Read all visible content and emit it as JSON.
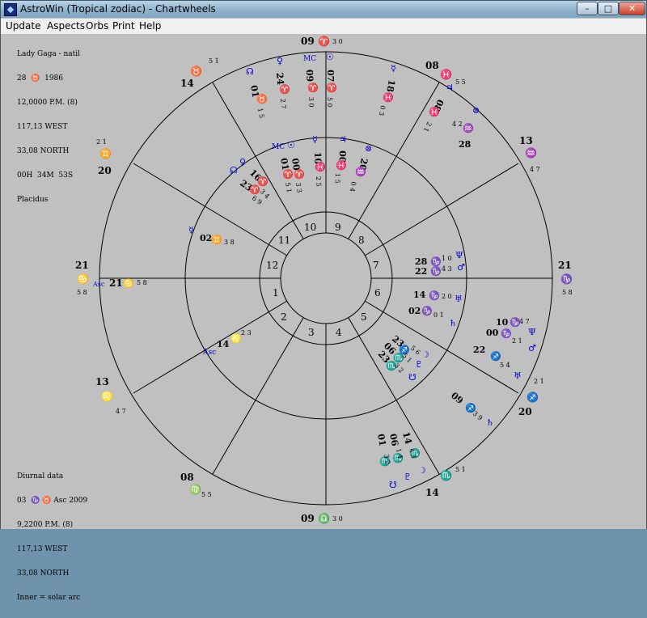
{
  "window": {
    "title": "AstroWin (Tropical zodiac) - Chartwheels",
    "min_label": "–",
    "max_label": "□",
    "close_label": "✕"
  },
  "menu": [
    "Update",
    "Aspects",
    "Orbs",
    "Print",
    "Help"
  ],
  "natal_info": [
    "Lady Gaga - natil",
    "28  ♉  1986",
    "12,0000 P.M. (8)",
    "117,13 WEST",
    "33,08 NORTH",
    "00H  34M  53S",
    "Placidus"
  ],
  "diurnal_info": [
    "Diurnal data",
    "03  ♑ ♉ Asc 2009",
    "9,2200 P.M. (8)",
    "117,13 WEST",
    "33,08 NORTH",
    "Inner = solar arc"
  ],
  "houses": [
    "1",
    "2",
    "3",
    "4",
    "5",
    "6",
    "7",
    "8",
    "9",
    "10",
    "11",
    "12"
  ],
  "outer_cusps": {
    "mc": {
      "deg": "09",
      "sign": "♈",
      "min": "3 0"
    },
    "h11": {
      "deg": "08",
      "sign": "♓",
      "min": "5 5"
    },
    "h12": {
      "deg": "13",
      "sign": "♒",
      "min": "4 7"
    },
    "asc": {
      "deg": "21",
      "sign": "♑",
      "min": "5 8"
    },
    "h2": {
      "deg": "20",
      "sign": "♐",
      "min": "2 1"
    },
    "h3": {
      "deg": "14",
      "sign": "♏",
      "min": "5 1"
    },
    "ic": {
      "deg": "09",
      "sign": "♎",
      "min": "3 0"
    },
    "h5": {
      "deg": "08",
      "sign": "♍",
      "min": "5 5"
    },
    "h6": {
      "deg": "13",
      "sign": "♌",
      "min": "4 7"
    },
    "dsc": {
      "deg": "21",
      "sign": "♋",
      "min": "5 8"
    },
    "h8": {
      "deg": "20",
      "sign": "♊",
      "min": "2 1"
    },
    "h9": {
      "deg": "14",
      "sign": "♉",
      "min": "5 1"
    }
  },
  "outer_planets": [
    {
      "glyph": "☊",
      "deg": "01",
      "sign": "♉",
      "min": "1 5"
    },
    {
      "glyph": "♀",
      "deg": "24",
      "sign": "♈",
      "min": "2 7"
    },
    {
      "glyph": "MC",
      "deg": "09",
      "sign": "♈",
      "min": "3 0"
    },
    {
      "glyph": "☉",
      "deg": "07",
      "sign": "♈",
      "min": "5 0"
    },
    {
      "glyph": "☿",
      "deg": "18",
      "sign": "♓",
      "min": "0 3"
    },
    {
      "glyph": "♃",
      "deg": "08",
      "sign": "♓",
      "min": "2 1"
    },
    {
      "glyph": "⊗",
      "deg": "28",
      "sign": "♒",
      "min": "4 2"
    },
    {
      "glyph": "Ψ",
      "deg": "10",
      "sign": "♑",
      "min": "4 7"
    },
    {
      "glyph": "♂",
      "deg": "00",
      "sign": "♑",
      "min": "2 1"
    },
    {
      "glyph": "♅",
      "deg": "22",
      "sign": "♐",
      "min": "5 4"
    },
    {
      "glyph": "♄",
      "deg": "09",
      "sign": "♐",
      "min": "3 9"
    },
    {
      "glyph": "☽",
      "deg": "14",
      "sign": "♏",
      "min": "4 3"
    },
    {
      "glyph": "♇",
      "deg": "06",
      "sign": "♏",
      "min": "1 4"
    },
    {
      "glyph": "☋",
      "deg": "01",
      "sign": "♏",
      "min": "3 2"
    }
  ],
  "inner_planets": [
    {
      "glyph": "☊",
      "deg": "23",
      "sign": "♈",
      "min": "6 9"
    },
    {
      "glyph": "♀",
      "deg": "16",
      "sign": "♈",
      "min": "3 4"
    },
    {
      "glyph": "MC",
      "deg": "01",
      "sign": "♈",
      "min": "5 1"
    },
    {
      "glyph": "☉",
      "deg": "00",
      "sign": "♈",
      "min": "3 3"
    },
    {
      "glyph": "☿",
      "deg": "10",
      "sign": "♓",
      "min": "2 5"
    },
    {
      "glyph": "♃",
      "deg": "00",
      "sign": "♓",
      "min": "1 5"
    },
    {
      "glyph": "⊗",
      "deg": "20",
      "sign": "♒",
      "min": "0 4"
    },
    {
      "glyph": "☿",
      "deg": "02",
      "sign": "♊",
      "min": "3 8"
    },
    {
      "glyph": "Ψ",
      "deg": "28",
      "sign": "♑",
      "min": "1 0"
    },
    {
      "glyph": "♂",
      "deg": "22",
      "sign": "♑",
      "min": "4 3"
    },
    {
      "glyph": "♅",
      "deg": "14",
      "sign": "♑",
      "min": "2 0"
    },
    {
      "glyph": "♄",
      "deg": "02",
      "sign": "♑",
      "min": "0 1"
    },
    {
      "glyph": "Asc",
      "deg": "14",
      "sign": "♌",
      "min": "2 3"
    },
    {
      "glyph": "☽",
      "deg": "23",
      "sign": "♐",
      "min": "5 6"
    },
    {
      "glyph": "♇",
      "deg": "06",
      "sign": "♏",
      "min": "5 1"
    },
    {
      "glyph": "☋",
      "deg": "23",
      "sign": "♏",
      "min": "3 2"
    }
  ],
  "asc_label": "Asc"
}
